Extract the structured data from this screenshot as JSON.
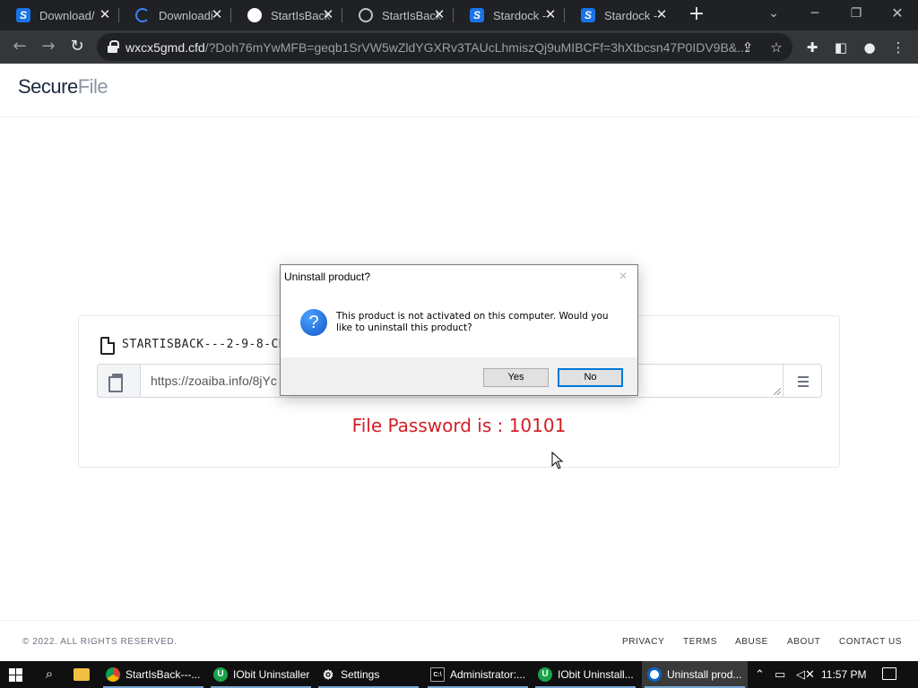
{
  "browser": {
    "tabs": [
      {
        "title": "Download/",
        "favicon": "stardock-icon",
        "active": false
      },
      {
        "title": "Downloadi",
        "favicon": "loading-spinner-icon",
        "active": false
      },
      {
        "title": "StartIsBack",
        "favicon": "github-icon",
        "active": false
      },
      {
        "title": "StartIsBack",
        "favicon": "globe-icon",
        "active": false
      },
      {
        "title": "Stardock -",
        "favicon": "stardock-icon",
        "active": false
      },
      {
        "title": "Stardock -",
        "favicon": "stardock-icon",
        "active": false
      }
    ],
    "address_host": "wxcx5gmd.cfd",
    "address_path": "/?Doh76mYwMFB=geqb1SrVW5wZldYGXRv3TAUcLhmiszQj9uMIBCFf=3hXtbcsn47P0IDV9B&...",
    "colors": {
      "tabstrip": "#202124",
      "toolbar": "#35363a",
      "omnibox": "#202124"
    }
  },
  "site": {
    "logo_part1": "Secure",
    "logo_part2": "File",
    "file_name": "STARTISBACK---2-9-8-CR",
    "download_url": "https://zoaiba.info/8jYc",
    "password_text": "File Password is : 10101",
    "password_color": "#d21f26",
    "footer": {
      "copyright": "© 2022. ALL RIGHTS RESERVED.",
      "links": [
        "PRIVACY",
        "TERMS",
        "ABUSE",
        "ABOUT",
        "CONTACT US"
      ]
    }
  },
  "dialog": {
    "title": "Uninstall product?",
    "message": "This product is not activated on this computer.  Would you like to uninstall this product?",
    "yes_label": "Yes",
    "no_label": "No",
    "accent": "#0078d7"
  },
  "taskbar": {
    "items": [
      {
        "label": "StartIsBack---...",
        "icon": "chrome-icon"
      },
      {
        "label": "IObit Uninstaller",
        "icon": "iobit-icon"
      },
      {
        "label": "Settings",
        "icon": "gear-icon"
      },
      {
        "label": "Administrator:...",
        "icon": "cmd-icon"
      },
      {
        "label": "IObit Uninstall...",
        "icon": "iobit-icon"
      },
      {
        "label": "Uninstall prod...",
        "icon": "uninstaller-icon"
      }
    ],
    "time": "11:57 PM"
  }
}
